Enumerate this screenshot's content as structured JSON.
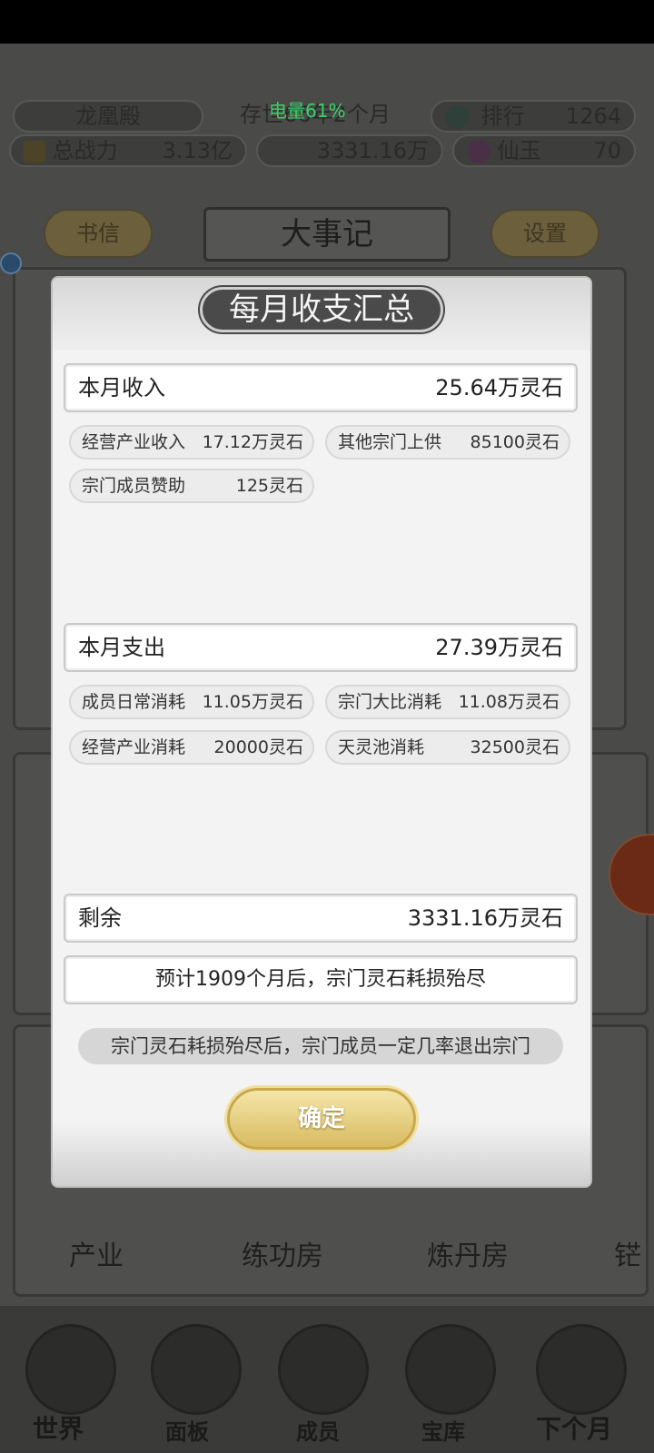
{
  "status_bar": {
    "battery_label": "电量61%"
  },
  "header": {
    "sect_name": "龙凰殿",
    "existence": "存世66年2个月",
    "rank_label": "排行",
    "rank_value": "1264",
    "power_label": "总战力",
    "power_value": "3.13亿",
    "spirit_stone_value": "3331.16万",
    "jade_label": "仙玉",
    "jade_value": "70"
  },
  "toolbar": {
    "letters_label": "书信",
    "title": "大事记",
    "settings_label": "设置"
  },
  "facilities": [
    "产业",
    "练功房",
    "炼丹房",
    "铓"
  ],
  "nav": [
    "世界",
    "面板",
    "成员",
    "宝库",
    "下个月"
  ],
  "modal": {
    "title": "每月收支汇总",
    "income": {
      "label": "本月收入",
      "total": "25.64万灵石",
      "items": [
        {
          "label": "经营产业收入",
          "value": "17.12万灵石"
        },
        {
          "label": "其他宗门上供",
          "value": "85100灵石"
        },
        {
          "label": "宗门成员赞助",
          "value": "125灵石"
        }
      ]
    },
    "expense": {
      "label": "本月支出",
      "total": "27.39万灵石",
      "items": [
        {
          "label": "成员日常消耗",
          "value": "11.05万灵石"
        },
        {
          "label": "宗门大比消耗",
          "value": "11.08万灵石"
        },
        {
          "label": "经营产业消耗",
          "value": "20000灵石"
        },
        {
          "label": "天灵池消耗",
          "value": "32500灵石"
        }
      ]
    },
    "balance": {
      "label": "剩余",
      "value": "3331.16万灵石"
    },
    "forecast": "预计1909个月后，宗门灵石耗损殆尽",
    "warning": "宗门灵石耗损殆尽后，宗门成员一定几率退出宗门",
    "confirm_label": "确定"
  }
}
